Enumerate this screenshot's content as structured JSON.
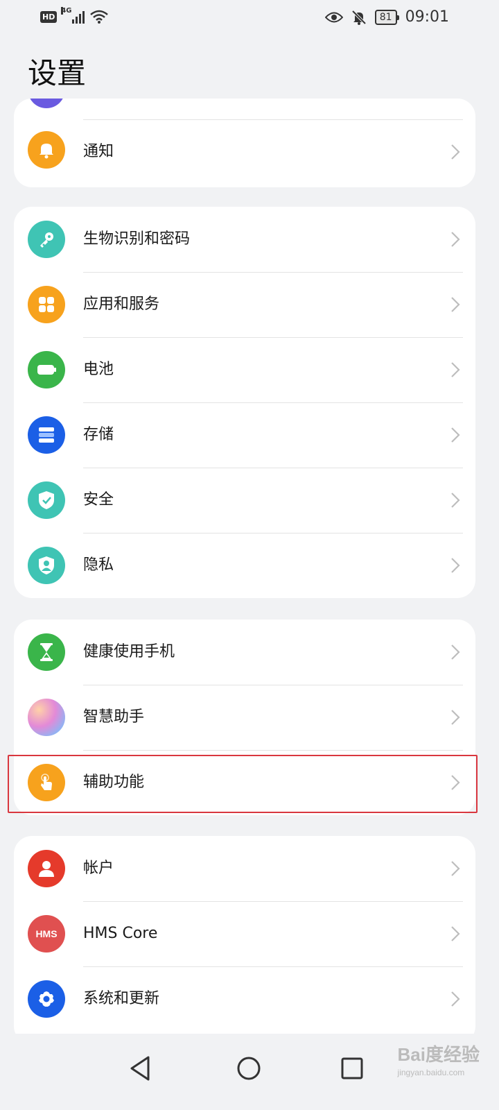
{
  "status_bar": {
    "hd": "HD",
    "network": "4G",
    "battery": "81",
    "time": "09:01"
  },
  "title": "设置",
  "groups": [
    {
      "items": [
        {
          "label": "",
          "icon": "partial-icon",
          "color": "#6a5ae0"
        },
        {
          "label": "通知",
          "icon": "bell-icon",
          "color": "#f7a21d"
        }
      ]
    },
    {
      "items": [
        {
          "label": "生物识别和密码",
          "icon": "key-icon",
          "color": "#3fc4b4"
        },
        {
          "label": "应用和服务",
          "icon": "apps-grid-icon",
          "color": "#f7a21d"
        },
        {
          "label": "电池",
          "icon": "battery-icon",
          "color": "#3ab54a"
        },
        {
          "label": "存储",
          "icon": "storage-icon",
          "color": "#1b5fe6"
        },
        {
          "label": "安全",
          "icon": "shield-check-icon",
          "color": "#3fc4b4"
        },
        {
          "label": "隐私",
          "icon": "privacy-shield-icon",
          "color": "#3fc4b4"
        }
      ]
    },
    {
      "items": [
        {
          "label": "健康使用手机",
          "icon": "hourglass-icon",
          "color": "#3ab54a"
        },
        {
          "label": "智慧助手",
          "icon": "assistant-icon",
          "color": "#c88de0"
        },
        {
          "label": "辅助功能",
          "icon": "hand-touch-icon",
          "color": "#f7a21d"
        }
      ]
    },
    {
      "items": [
        {
          "label": "帐户",
          "icon": "account-icon",
          "color": "#e53a2b"
        },
        {
          "label": "HMS Core",
          "icon": "hms-icon",
          "color": "#e05050"
        },
        {
          "label": "系统和更新",
          "icon": "gear-icon",
          "color": "#1b5fe6"
        }
      ]
    }
  ],
  "watermark": {
    "brand": "Bai度经验",
    "url": "jingyan.baidu.com"
  }
}
